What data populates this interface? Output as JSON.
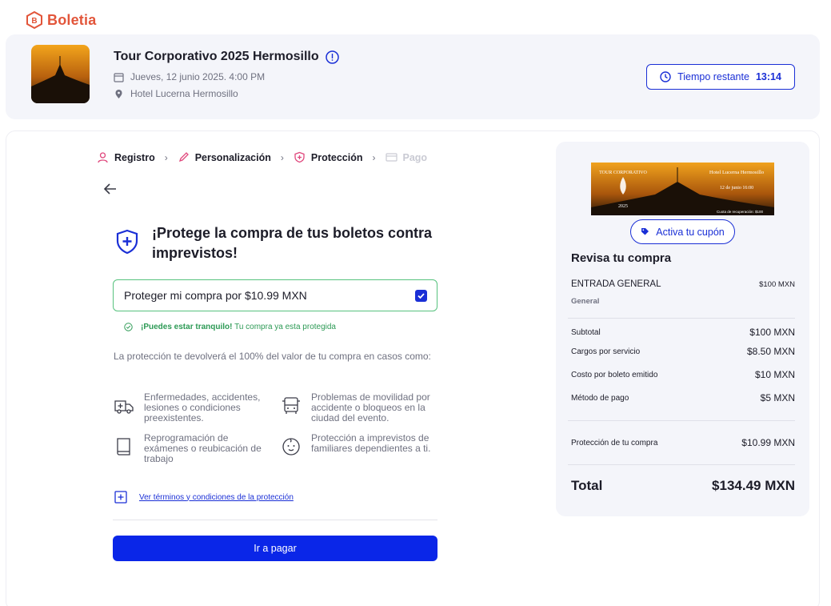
{
  "brand": {
    "name": "Boletia",
    "color": "#e2553a"
  },
  "event": {
    "title": "Tour Corporativo 2025 Hermosillo",
    "date": "Jueves, 12 junio 2025. 4:00 PM",
    "venue": "Hotel Lucerna Hermosillo",
    "timer_label": "Tiempo restante",
    "timer_value": "13:14"
  },
  "steps": [
    {
      "label": "Registro",
      "icon": "user-icon",
      "state": "done"
    },
    {
      "label": "Personalización",
      "icon": "pencil-icon",
      "state": "done"
    },
    {
      "label": "Protección",
      "icon": "shield-icon",
      "state": "current"
    },
    {
      "label": "Pago",
      "icon": "card-icon",
      "state": "disabled"
    }
  ],
  "protection": {
    "heading": "¡Protege la compra de tus boletos contra imprevistos!",
    "checkbox_label": "Proteger mi compra por $10.99 MXN",
    "checked": true,
    "assure_bold": "¡Puedes estar tranquilo!",
    "assure_text": "Tu compra ya esta protegida",
    "description": "La protección te devolverá el 100% del valor de tu compra en casos como:",
    "benefits": [
      {
        "icon": "ambulance-icon",
        "text": "Enfermedades, accidentes, lesiones o condiciones preexistentes."
      },
      {
        "icon": "bus-icon",
        "text": "Problemas de movilidad por accidente o bloqueos en la ciudad del evento."
      },
      {
        "icon": "book-icon",
        "text": "Reprogramación de exámenes o reubicación de trabajo"
      },
      {
        "icon": "baby-face-icon",
        "text": "Protección a imprevistos de familiares dependientes a ti."
      }
    ],
    "terms_link": "Ver términos y condiciones de la protección",
    "pay_button": "Ir a pagar"
  },
  "summary": {
    "banner_text": {
      "brand": "TOUR CORPORATIVO",
      "year": "2025",
      "venue": "Hotel Lucerna Hermosillo",
      "date": "12 de junio 16:00",
      "fee": "Cuota de recuperación: $100"
    },
    "coupon_button": "Activa tu cupón",
    "title": "Revisa tu compra",
    "entry_name": "ENTRADA GENERAL",
    "entry_sub": "General",
    "entry_price": "$100 MXN",
    "lines": [
      {
        "label": "Subtotal",
        "value": "$100 MXN"
      },
      {
        "label": "Cargos por servicio",
        "value": "$8.50 MXN"
      },
      {
        "label": "Costo por boleto emitido",
        "value": "$10 MXN"
      },
      {
        "label": "Método de pago",
        "value": "$5 MXN"
      }
    ],
    "protection_line": {
      "label": "Protección de tu compra",
      "value": "$10.99 MXN"
    },
    "total_label": "Total",
    "total_value": "$134.49 MXN"
  },
  "colors": {
    "accent": "#1a2fd6",
    "button": "#0a26e8",
    "success": "#57c27e",
    "panel": "#f4f5fa"
  }
}
